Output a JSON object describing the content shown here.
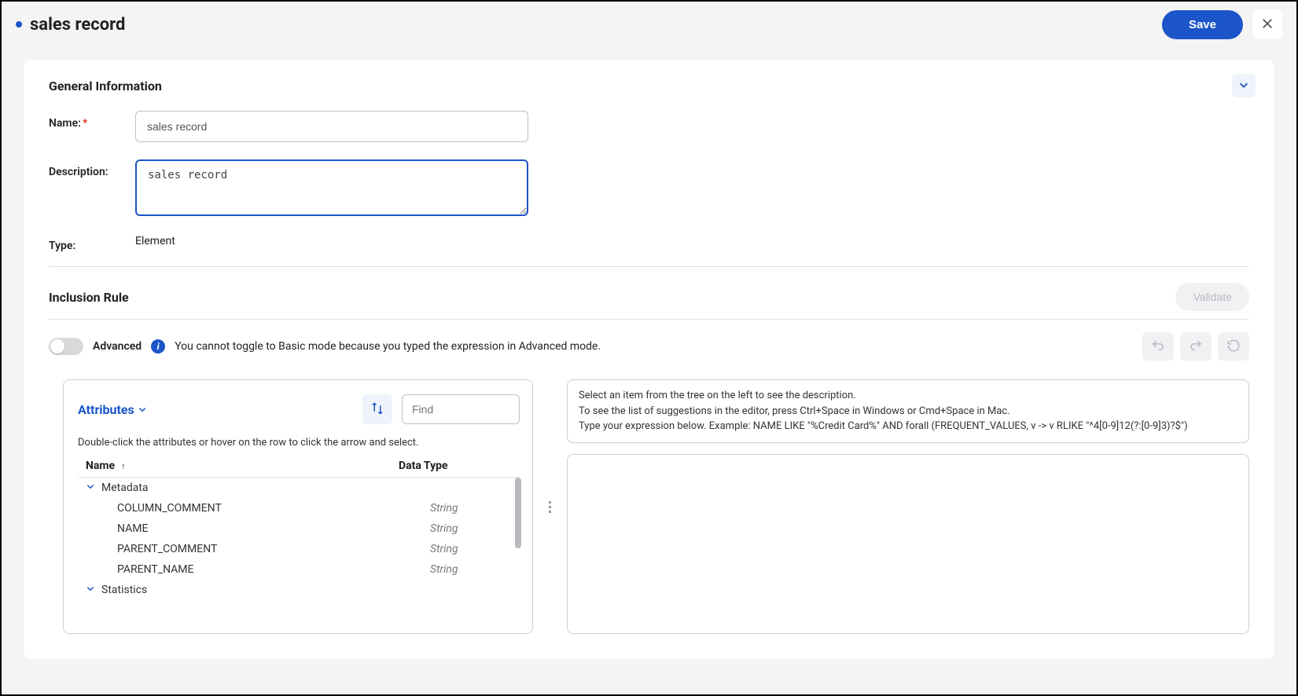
{
  "header": {
    "title": "sales record",
    "save_label": "Save"
  },
  "general": {
    "section_title": "General Information",
    "name_label": "Name:",
    "name_value": "sales record",
    "description_label": "Description:",
    "description_value": "sales record",
    "type_label": "Type:",
    "type_value": "Element"
  },
  "inclusion": {
    "section_title": "Inclusion Rule",
    "validate_label": "Validate",
    "advanced_label": "Advanced",
    "toggle_info": "You cannot toggle to Basic mode because you typed the expression in Advanced mode."
  },
  "attributes": {
    "dropdown_label": "Attributes",
    "find_placeholder": "Find",
    "hint": "Double-click the attributes or hover on the row to click the arrow and select.",
    "col_name": "Name",
    "col_type": "Data Type",
    "groups": [
      {
        "label": "Metadata",
        "items": [
          {
            "name": "COLUMN_COMMENT",
            "type": "String"
          },
          {
            "name": "NAME",
            "type": "String"
          },
          {
            "name": "PARENT_COMMENT",
            "type": "String"
          },
          {
            "name": "PARENT_NAME",
            "type": "String"
          }
        ]
      },
      {
        "label": "Statistics",
        "items": []
      }
    ]
  },
  "expression": {
    "hint1": "Select an item from the tree on the left to see the description.",
    "hint2": "To see the list of suggestions in the editor, press Ctrl+Space in Windows or Cmd+Space in Mac.",
    "hint3": "Type your expression below. Example: NAME LIKE \"%Credit Card%\" AND forall (FREQUENT_VALUES, v -> v RLIKE \"^4[0-9]12(?:[0-9]3)?$\")"
  }
}
